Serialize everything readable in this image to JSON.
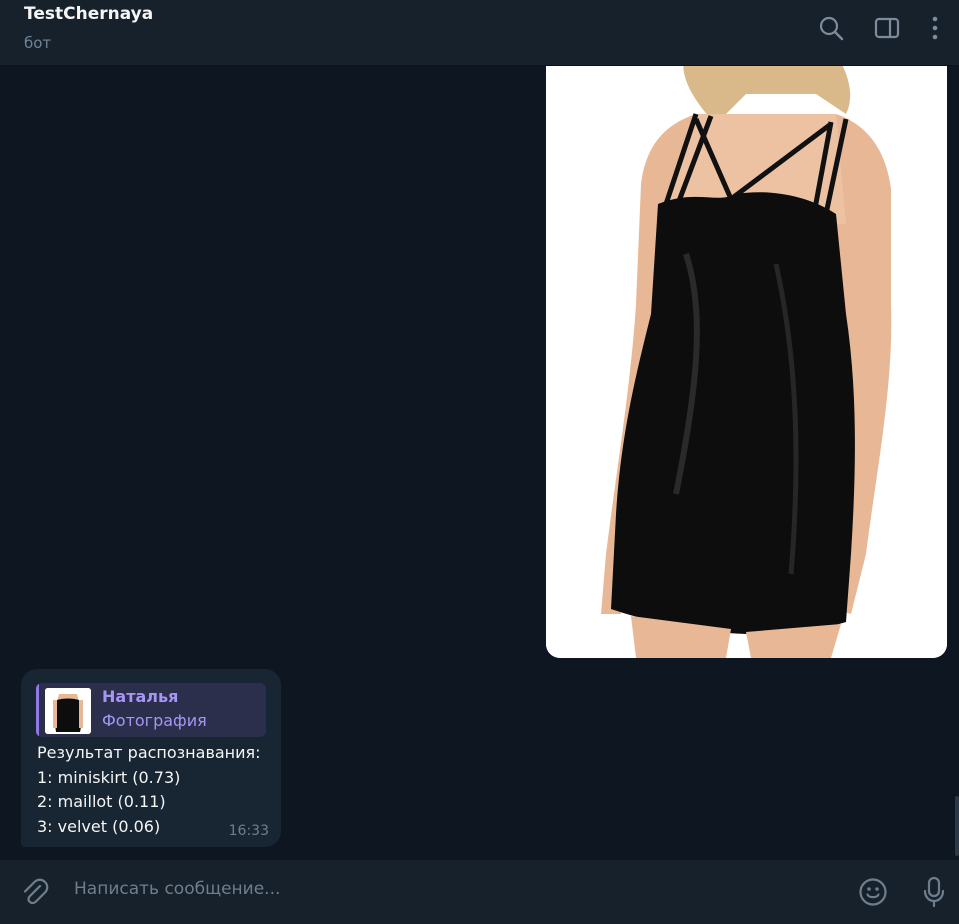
{
  "header": {
    "title": "TestChernaya",
    "subtitle": "бот",
    "icons": [
      "search-icon",
      "sidebar-toggle-icon",
      "more-vertical-icon"
    ]
  },
  "messages": {
    "photo": {
      "description_icon": "dress-photo"
    },
    "reply_message": {
      "reply_to": {
        "name": "Наталья",
        "type": "Фотография"
      },
      "lines": [
        "Результат распознавания:",
        "1: miniskirt (0.73)",
        "2: maillot (0.11)",
        "3: velvet (0.06)"
      ],
      "time": "16:33"
    }
  },
  "composer": {
    "placeholder": "Написать сообщение...",
    "icons": [
      "paperclip-icon",
      "emoji-icon",
      "microphone-icon"
    ]
  },
  "colors": {
    "background": "#0e1621",
    "panel": "#17212b",
    "bubble": "#182533",
    "accent": "#a695f5",
    "muted": "#6d7f8f"
  }
}
